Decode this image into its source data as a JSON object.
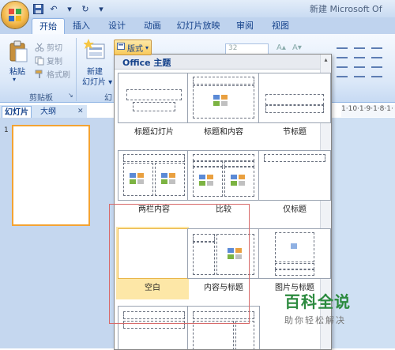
{
  "app": {
    "title": "新建 Microsoft Of"
  },
  "quick_access": [
    {
      "icon": "save-icon",
      "glyph": "💾"
    },
    {
      "icon": "undo-icon",
      "glyph": "↶"
    },
    {
      "icon": "redo-icon",
      "glyph": "↻"
    },
    {
      "icon": "customize-icon",
      "glyph": "▾"
    }
  ],
  "tabs": [
    "开始",
    "插入",
    "设计",
    "动画",
    "幻灯片放映",
    "审阅",
    "视图"
  ],
  "clipboard": {
    "paste": "粘贴",
    "cut": "剪切",
    "copy": "复制",
    "format_painter": "格式刷",
    "group": "剪贴板"
  },
  "slides_group": {
    "new_slide_line1": "新建",
    "new_slide_line2": "幻灯片",
    "group_partial": "幻",
    "layout_button": "版式"
  },
  "font_size_partial": "32",
  "left_pane": {
    "tab_slides": "幻灯片",
    "tab_outline": "大纲",
    "slide_number": "1"
  },
  "ruler_text": "1·10·1·9·1·8·1·",
  "gallery": {
    "header": "Office 主题",
    "items": [
      {
        "label": "标题幻灯片"
      },
      {
        "label": "标题和内容"
      },
      {
        "label": "节标题"
      },
      {
        "label": "两栏内容"
      },
      {
        "label": "比较"
      },
      {
        "label": "仅标题"
      },
      {
        "label": "空白",
        "selected": true
      },
      {
        "label": "内容与标题"
      },
      {
        "label": "图片与标题"
      }
    ]
  },
  "watermark": {
    "main": "百科全说",
    "sub": "助你轻松解决"
  },
  "colors": {
    "accent": "#f3a333",
    "selected": "#fde7a7",
    "ribbon": "#dbe8f8",
    "watermark": "#2b8a3e"
  }
}
